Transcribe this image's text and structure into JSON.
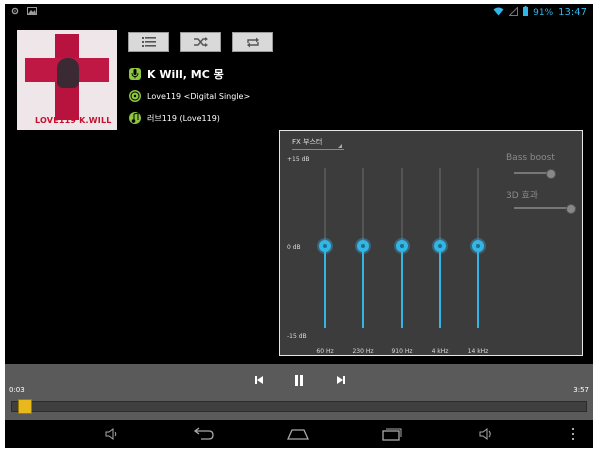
{
  "status_bar": {
    "time": "13:47",
    "battery_percent": "91%",
    "icons": [
      "settings-icon",
      "gallery-icon",
      "wifi-icon",
      "signal-icon",
      "battery-icon"
    ]
  },
  "now_playing": {
    "artist": "K Will, MC 몽",
    "album": "Love119 <Digital Single>",
    "track": "러브119 (Love119)",
    "album_art_text": "LOVE119 K.WILL"
  },
  "top_buttons": [
    "playlist-icon",
    "shuffle-icon",
    "repeat-icon"
  ],
  "equalizer": {
    "preset_label": "FX 부스터",
    "db_labels": {
      "top": "+15 dB",
      "mid": "0 dB",
      "bottom": "-15 dB"
    },
    "bands": [
      {
        "label": "60 Hz",
        "gain_db": 0
      },
      {
        "label": "230 Hz",
        "gain_db": 0
      },
      {
        "label": "910 Hz",
        "gain_db": 0
      },
      {
        "label": "4 kHz",
        "gain_db": 0
      },
      {
        "label": "14 kHz",
        "gain_db": 0
      }
    ],
    "bass_boost_label": "Bass boost",
    "effect_3d_label": "3D 효과",
    "bass_boost_level": 0.9,
    "effect_3d_level": 0.9,
    "accent_color": "#33b5e5"
  },
  "playback": {
    "current_time": "0:03",
    "total_time": "3:57",
    "progress_fraction": 0.013
  },
  "nav_icons": [
    "volume-down-icon",
    "back-icon",
    "home-icon",
    "recent-apps-icon",
    "volume-up-icon",
    "menu-icon"
  ]
}
